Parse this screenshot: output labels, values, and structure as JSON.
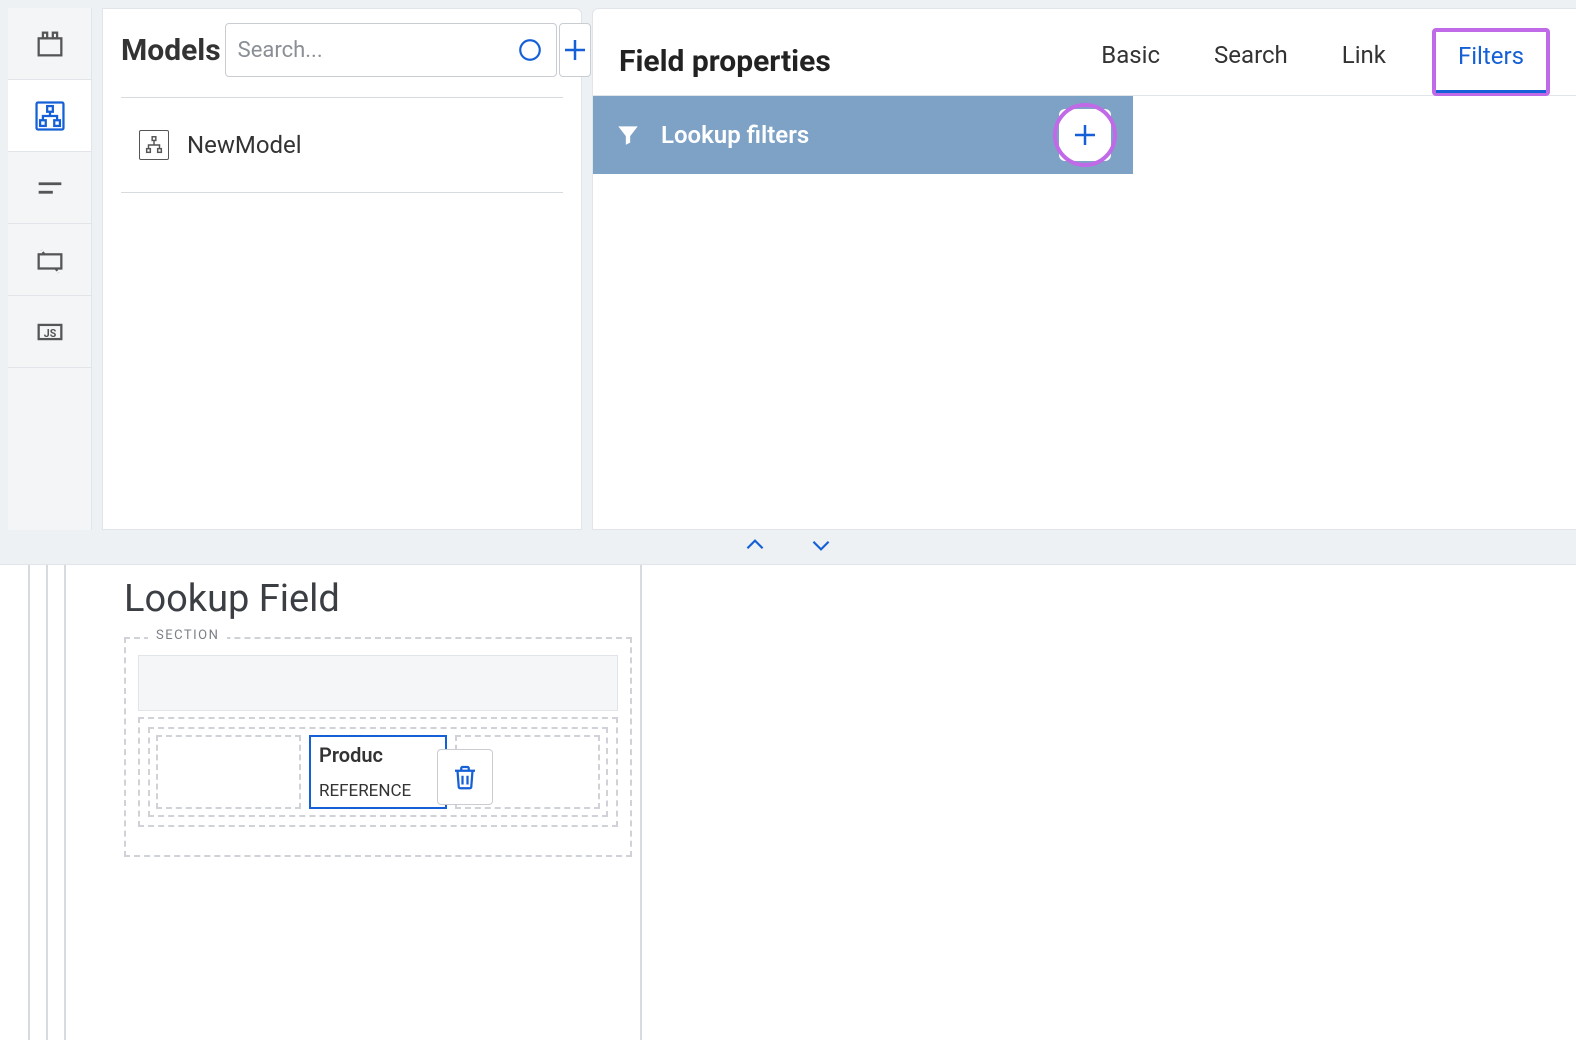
{
  "models_panel": {
    "title": "Models",
    "search_placeholder": "Search...",
    "items": [
      {
        "label": "NewModel"
      }
    ]
  },
  "props_panel": {
    "title": "Field properties",
    "tabs": [
      {
        "label": "Basic"
      },
      {
        "label": "Search"
      },
      {
        "label": "Link"
      },
      {
        "label": "Filters"
      }
    ],
    "lookup_filters_label": "Lookup filters"
  },
  "canvas": {
    "page_title": "Lookup Field",
    "section_label": "SECTION",
    "field_chip": {
      "line1": "Produc",
      "line2": "REFERENCE"
    }
  }
}
